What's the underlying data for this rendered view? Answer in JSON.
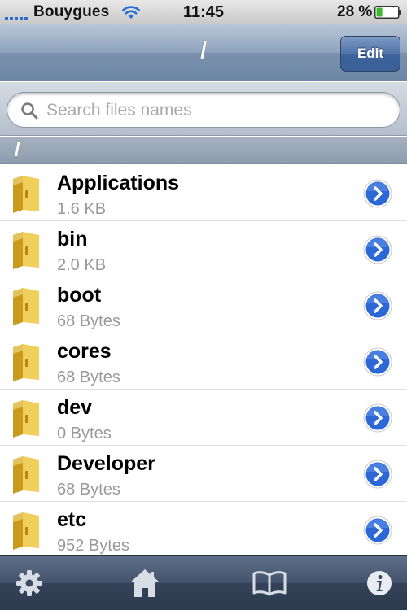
{
  "status_bar": {
    "carrier": "Bouygues",
    "time": "11:45",
    "battery": "28 %",
    "battery_level": 0.28
  },
  "nav_bar": {
    "title": "/",
    "edit_label": "Edit"
  },
  "search": {
    "placeholder": "Search files names",
    "value": ""
  },
  "section": {
    "title": "/"
  },
  "files": [
    {
      "name": "Applications",
      "size": "1.6 KB"
    },
    {
      "name": "bin",
      "size": "2.0 KB"
    },
    {
      "name": "boot",
      "size": "68 Bytes"
    },
    {
      "name": "cores",
      "size": "68 Bytes"
    },
    {
      "name": "dev",
      "size": "0 Bytes"
    },
    {
      "name": "Developer",
      "size": "68 Bytes"
    },
    {
      "name": "etc",
      "size": "952 Bytes"
    }
  ],
  "tabs": [
    {
      "icon": "gear-icon"
    },
    {
      "icon": "home-icon"
    },
    {
      "icon": "book-icon"
    },
    {
      "icon": "info-icon"
    }
  ],
  "colors": {
    "nav_bar": "#8fa3bd",
    "edit_button": "#4f72a8",
    "tab_bar": "#3a4a62",
    "disclosure": "#2b67d6",
    "folder": "#e8c24a"
  }
}
